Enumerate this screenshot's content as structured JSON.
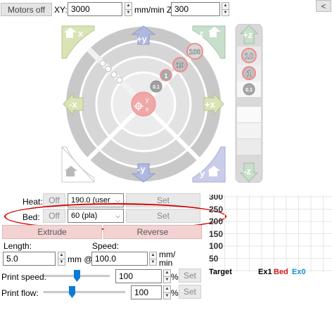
{
  "toolbar": {
    "motors_off_label": "Motors off",
    "xy_label": "XY:",
    "xy_value": "3000",
    "feed_units_label": "mm/min Z:",
    "z_value": "300",
    "collapse_label": "<"
  },
  "jog": {
    "home_x_label": "x",
    "home_y_label": "y",
    "home_z_label": "z",
    "home_all_label": "",
    "plus_y_label": "+y",
    "minus_y_label": "-y",
    "plus_x_label": "+x",
    "minus_x_label": "-x",
    "steps": [
      "100",
      "10",
      "1",
      "0.1"
    ],
    "center_y_label": "y",
    "center_x_label": "x",
    "z_plus_label": "+z",
    "z_minus_label": "-z",
    "z_steps": [
      "10",
      "1",
      "0.1"
    ]
  },
  "temperature": {
    "heat_label": "Heat:",
    "heat_off_label": "Off",
    "heat_preset": "190.0 (user",
    "heat_set_label": "Set",
    "bed_label": "Bed:",
    "bed_off_label": "Off",
    "bed_preset": "60 (pla)",
    "bed_set_label": "Set"
  },
  "extrude": {
    "extrude_label": "Extrude",
    "reverse_label": "Reverse",
    "length_label": "Length:",
    "length_value": "5.0",
    "mm_at_label": "mm @",
    "speed_label": "Speed:",
    "speed_value": "100.0",
    "speed_units": "mm/\nmin"
  },
  "print_controls": {
    "print_speed_label": "Print speed:",
    "print_speed_value": "100",
    "print_speed_fraction": 0.5,
    "print_flow_label": "Print flow:",
    "print_flow_value": "100",
    "print_flow_fraction": 0.5,
    "percent": "%",
    "set_label": "Set"
  },
  "graph": {
    "y_ticks": [
      "300",
      "250",
      "200",
      "150",
      "100",
      "50"
    ],
    "legend": [
      {
        "name": "Target",
        "color": "#000000"
      },
      {
        "name": "Ex1",
        "color": "#000000"
      },
      {
        "name": "Bed",
        "color": "#d21e1e"
      },
      {
        "name": "Ex0",
        "color": "#1e8fd2"
      }
    ]
  },
  "colors": {
    "highlight_ellipse": "#d40000",
    "extrude_bg": "#f3d2d2",
    "home_x_bg": "#d8e4b4",
    "home_z_bg": "#c7dfcb",
    "home_y_bg": "#c9cdea",
    "arrow_fill": "#aeb8e0",
    "center_fill": "#f0a7a7"
  }
}
